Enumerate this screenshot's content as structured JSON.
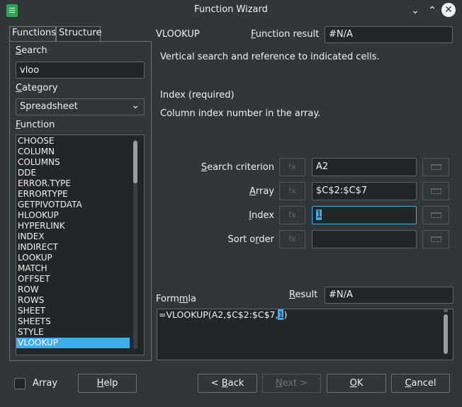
{
  "window": {
    "title": "Function Wizard",
    "minimize_glyph": "⌄",
    "maximize_glyph": "⌃",
    "close_glyph": "✕"
  },
  "tabs": {
    "functions": "Functions",
    "structure": "Structure"
  },
  "search": {
    "label": "Search",
    "value": "vloo"
  },
  "category": {
    "label": "Category",
    "value": "Spreadsheet",
    "arrow": "⌄"
  },
  "function_list": {
    "label": "Function",
    "items": [
      "CHOOSE",
      "COLUMN",
      "COLUMNS",
      "DDE",
      "ERROR.TYPE",
      "ERRORTYPE",
      "GETPIVOTDATA",
      "HLOOKUP",
      "HYPERLINK",
      "INDEX",
      "INDIRECT",
      "LOOKUP",
      "MATCH",
      "OFFSET",
      "ROW",
      "ROWS",
      "SHEET",
      "SHEETS",
      "STYLE",
      "VLOOKUP"
    ],
    "selected": "VLOOKUP"
  },
  "function_info": {
    "name": "VLOOKUP",
    "result_label": "Function result",
    "result_value": "#N/A",
    "description": "Vertical search and reference to indicated cells.",
    "param_title": "Index (required)",
    "param_description": "Column index number in the array."
  },
  "arguments": [
    {
      "label": "Search criterion",
      "value": "A2",
      "fx": "fx"
    },
    {
      "label": "Array",
      "value": "$C$2:$C$7",
      "fx": "fx"
    },
    {
      "label": "Index",
      "value": "1",
      "fx": "fx"
    },
    {
      "label": "Sort order",
      "value": "",
      "fx": "fx"
    }
  ],
  "formula": {
    "label": "Formula",
    "result_label": "Result",
    "result_value": "#N/A",
    "text_before": "=VLOOKUP(A2,$C$2:$C$7,",
    "text_highlight": "1",
    "text_after": ")"
  },
  "footer": {
    "array_label": "Array",
    "help": "Help",
    "back": "< Back",
    "next": "Next >",
    "ok": "OK",
    "cancel": "Cancel"
  },
  "colors": {
    "background": "#31363b",
    "field": "#232629",
    "accent": "#3daee9",
    "text": "#eff0f1"
  }
}
